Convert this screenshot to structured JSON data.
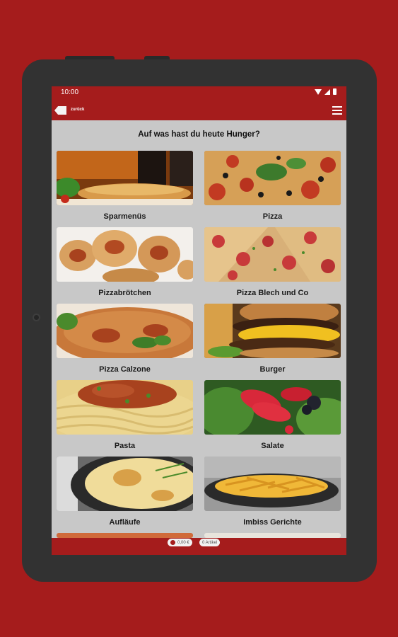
{
  "status": {
    "time": "10:00"
  },
  "appbar": {
    "back_label": "zurück"
  },
  "main": {
    "heading": "Auf was hast du heute Hunger?",
    "categories": [
      {
        "label": "Sparmenüs"
      },
      {
        "label": "Pizza"
      },
      {
        "label": "Pizzabrötchen"
      },
      {
        "label": "Pizza Blech und Co"
      },
      {
        "label": "Pizza Calzone"
      },
      {
        "label": "Burger"
      },
      {
        "label": "Pasta"
      },
      {
        "label": "Salate"
      },
      {
        "label": "Aufläufe"
      },
      {
        "label": "Imbiss Gerichte"
      }
    ]
  },
  "cart": {
    "total": "0,00 €",
    "items": "0 Artikel"
  },
  "colors": {
    "brand": "#a51c1c",
    "screen_bg": "#c8c8c8"
  }
}
